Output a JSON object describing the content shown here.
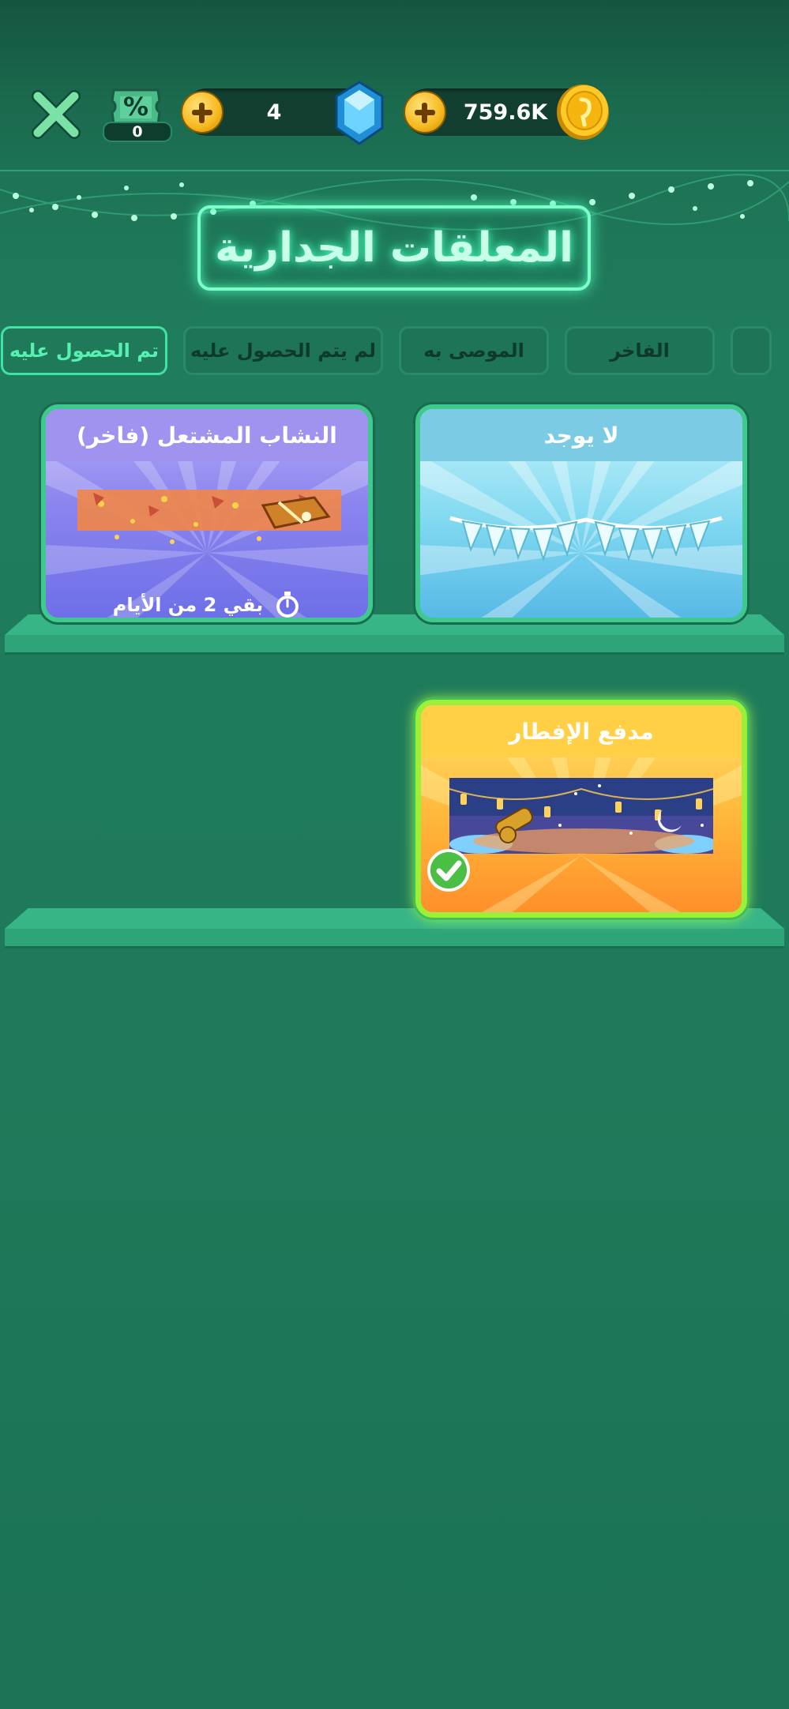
{
  "header": {
    "close_icon": "close-x-icon",
    "ticket": {
      "icon": "discount-ticket-icon",
      "symbol": "%",
      "count": "0"
    },
    "gems": {
      "value": "4",
      "icon": "blue-gem-icon"
    },
    "coins": {
      "value": "759.6K",
      "icon": "gold-coin-icon"
    }
  },
  "title": "المعلقات الجدارية",
  "tabs": [
    {
      "label": "تم الحصول عليه",
      "active": true
    },
    {
      "label": "لم يتم الحصول عليه",
      "active": false
    },
    {
      "label": "الموصى به",
      "active": false
    },
    {
      "label": "الفاخر",
      "active": false
    },
    {
      "label": "",
      "active": false
    }
  ],
  "cards": [
    {
      "title": "لا يوجد",
      "theme": "blue",
      "item_icon": "bunting-flags-icon"
    },
    {
      "title": "النشاب المشتعل (فاخر)",
      "theme": "purple",
      "item_icon": "flaming-crossbow-icon",
      "timer_icon": "stopwatch-icon",
      "timer_text": "بقي 2 من الأيام"
    },
    {
      "title": "مدفع الإفطار",
      "theme": "gold",
      "item_icon": "ramadan-cannon-icon",
      "selected": true,
      "check_icon": "check-icon"
    }
  ],
  "colors": {
    "background": "#1f7c5c",
    "accent_neon": "#58f0b2",
    "shelf": "#37b587"
  }
}
